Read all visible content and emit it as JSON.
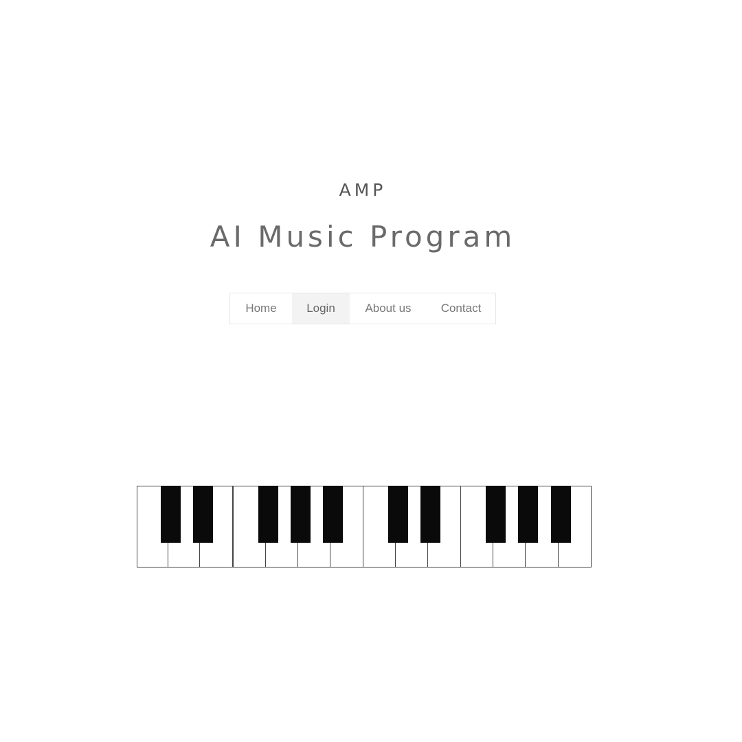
{
  "header": {
    "short_title": "AMP",
    "title": "AI Music Program"
  },
  "nav": {
    "items": [
      {
        "label": "Home",
        "active": false
      },
      {
        "label": "Login",
        "active": true
      },
      {
        "label": "About us",
        "active": false
      },
      {
        "label": "Contact",
        "active": false
      }
    ]
  },
  "piano": {
    "white_key_count": 14,
    "black_key_count": 10
  },
  "colors": {
    "white_key": "#ffffff",
    "black_key": "#0a0a0a",
    "key_border": "#444444",
    "title_text": "#6a6a6a",
    "nav_active_bg": "#f3f3f3"
  }
}
